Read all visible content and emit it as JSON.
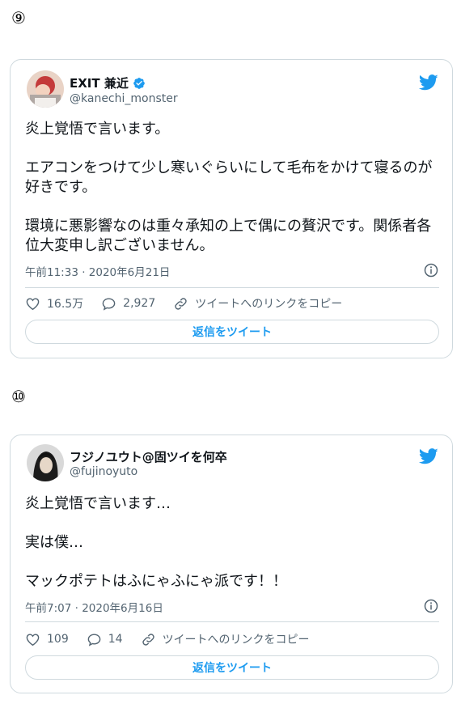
{
  "sections": [
    {
      "number": "⑨",
      "tweet": {
        "display_name": "EXIT 兼近",
        "handle": "@kanechi_monster",
        "verified": true,
        "paragraphs": [
          "炎上覚悟で言います。",
          "エアコンをつけて少し寒いぐらいにして毛布をかけて寝るのが好きです。",
          "環境に悪影響なのは重々承知の上で偶にの贅沢です。関係者各位大変申し訳ございません。"
        ],
        "timestamp": "午前11:33 · 2020年6月21日",
        "likes": "16.5万",
        "replies": "2,927",
        "copy_link_label": "ツイートへのリンクをコピー",
        "reply_button_label": "返信をツイート"
      }
    },
    {
      "number": "⑩",
      "tweet": {
        "display_name": "フジノユウト@固ツイを何卒",
        "handle": "@fujinoyuto",
        "verified": false,
        "paragraphs": [
          "炎上覚悟で言います…",
          "実は僕…",
          "マックポテトはふにゃふにゃ派です！！"
        ],
        "timestamp": "午前7:07 · 2020年6月16日",
        "likes": "109",
        "replies": "14",
        "copy_link_label": "ツイートへのリンクをコピー",
        "reply_button_label": "返信をツイート"
      }
    }
  ],
  "colors": {
    "accent": "#1d9bf0",
    "secondary_text": "#536471",
    "border": "#cfd9de"
  },
  "icons": [
    "verified-badge-icon",
    "twitter-bird-icon",
    "info-icon",
    "heart-icon",
    "reply-icon",
    "link-icon"
  ]
}
